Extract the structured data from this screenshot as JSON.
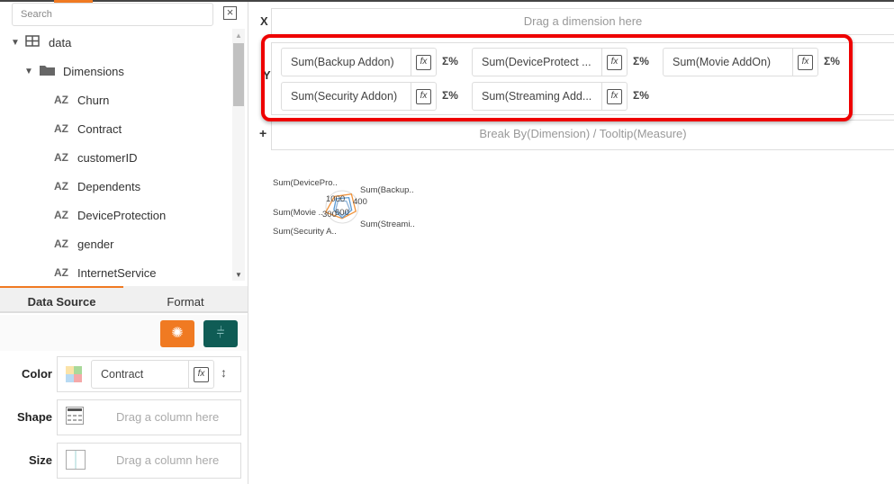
{
  "search": {
    "placeholder": "Search"
  },
  "tree": {
    "root": "data",
    "folder": "Dimensions",
    "type_icon": "AZ",
    "items": [
      "Churn",
      "Contract",
      "customerID",
      "Dependents",
      "DeviceProtection",
      "gender",
      "InternetService"
    ]
  },
  "tabs": [
    "Data Source",
    "Format"
  ],
  "wells": {
    "color": {
      "label": "Color",
      "value": "Contract"
    },
    "shape": {
      "label": "Shape",
      "placeholder": "Drag a column here"
    },
    "size": {
      "label": "Size",
      "placeholder": "Drag a column here"
    }
  },
  "shelves": {
    "x_label": "X",
    "x_placeholder": "Drag a dimension here",
    "y_label": "Y",
    "plus_label": "+",
    "breakby_placeholder": "Break By(Dimension) / Tooltip(Measure)",
    "y_pills": [
      "Sum(Backup Addon)",
      "Sum(DeviceProtect ...",
      "Sum(Movie AddOn)",
      "Sum(Security Addon)",
      "Sum(Streaming Add..."
    ]
  },
  "fx_label": "fx",
  "sigma_label": "Σ%",
  "colors": {
    "accent": "#f07a22",
    "teal": "#0f5c55",
    "highlight": "#e00000"
  },
  "chart_data": {
    "type": "radar",
    "axes": [
      "Sum(Backup..",
      "Sum(Streami..",
      "Sum(Security A..",
      "Sum(Movie ..",
      "Sum(DevicePro.."
    ],
    "tick_labels": [
      "1000",
      "400",
      "300",
      "600"
    ],
    "series_colors": [
      "#f0923a",
      "#5b9bd5",
      "#8fb4d9"
    ]
  }
}
